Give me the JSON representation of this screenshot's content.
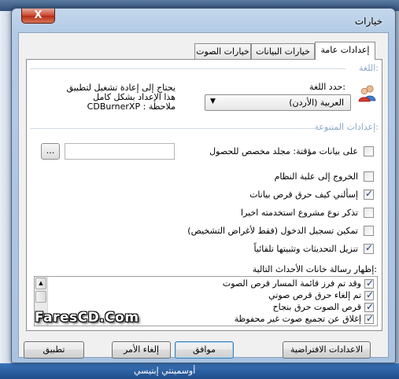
{
  "window": {
    "title": "خيارات",
    "close_glyph": "X"
  },
  "background": {
    "bottom_text": "أوسمينتي إبتيسي"
  },
  "tabs": [
    {
      "label": "إعدادات عامة",
      "active": true
    },
    {
      "label": "خيارات البيانات",
      "active": false
    },
    {
      "label": "خيارات الصوت",
      "active": false
    }
  ],
  "language": {
    "section_title": "اللغة:",
    "label": "حدد اللغة:",
    "selected": "العربية (الأردن)",
    "icon": "users-icon",
    "note_line1": "يحتاج إلى إعادة تشغيل لتطبيق",
    "note_line2": "هذا الإعداد بشكل كامل",
    "note_line3": "CDBurnerXP : ملاحظة"
  },
  "misc": {
    "section_title": "إعدادات المتنوعة:",
    "temp_folder_label": "على بيانات مؤقتة: مجلد مخصص للحصول",
    "temp_folder_value": "",
    "browse_label": "...",
    "options": [
      {
        "label": "الخروج إلى علبة النظام",
        "checked": false
      },
      {
        "label": "إسألني كيف حرق قرص بيانات",
        "checked": true
      },
      {
        "label": "تذكر نوع مشروع استخدمته اخيرا",
        "checked": false
      },
      {
        "label": "(تمكين تسجيل الدخول (فقط لأغراض التشخيص",
        "checked": false
      },
      {
        "label": "تنزيل التحديثات وتثبيتها تلقائياً",
        "checked": true
      }
    ]
  },
  "messages": {
    "label": "إظهار رسالة خانات الأحداث التالية:",
    "items": [
      {
        "label": "وقد تم فرز قائمة المسار قرص الصوت",
        "checked": true
      },
      {
        "label": "تم إلغاء حرق قرص صوتي",
        "checked": true
      },
      {
        "label": "قرص الصوت حرق بنجاح",
        "checked": true
      },
      {
        "label": "إغلاق عن تجميع صوت غير محفوظة",
        "checked": true
      }
    ]
  },
  "buttons": {
    "defaults": "الاعدادات الافتراضية",
    "ok": "موافق",
    "cancel": "إلغاء الأمر",
    "apply": "تطبيق"
  },
  "watermark": "FaresCD.Com"
}
